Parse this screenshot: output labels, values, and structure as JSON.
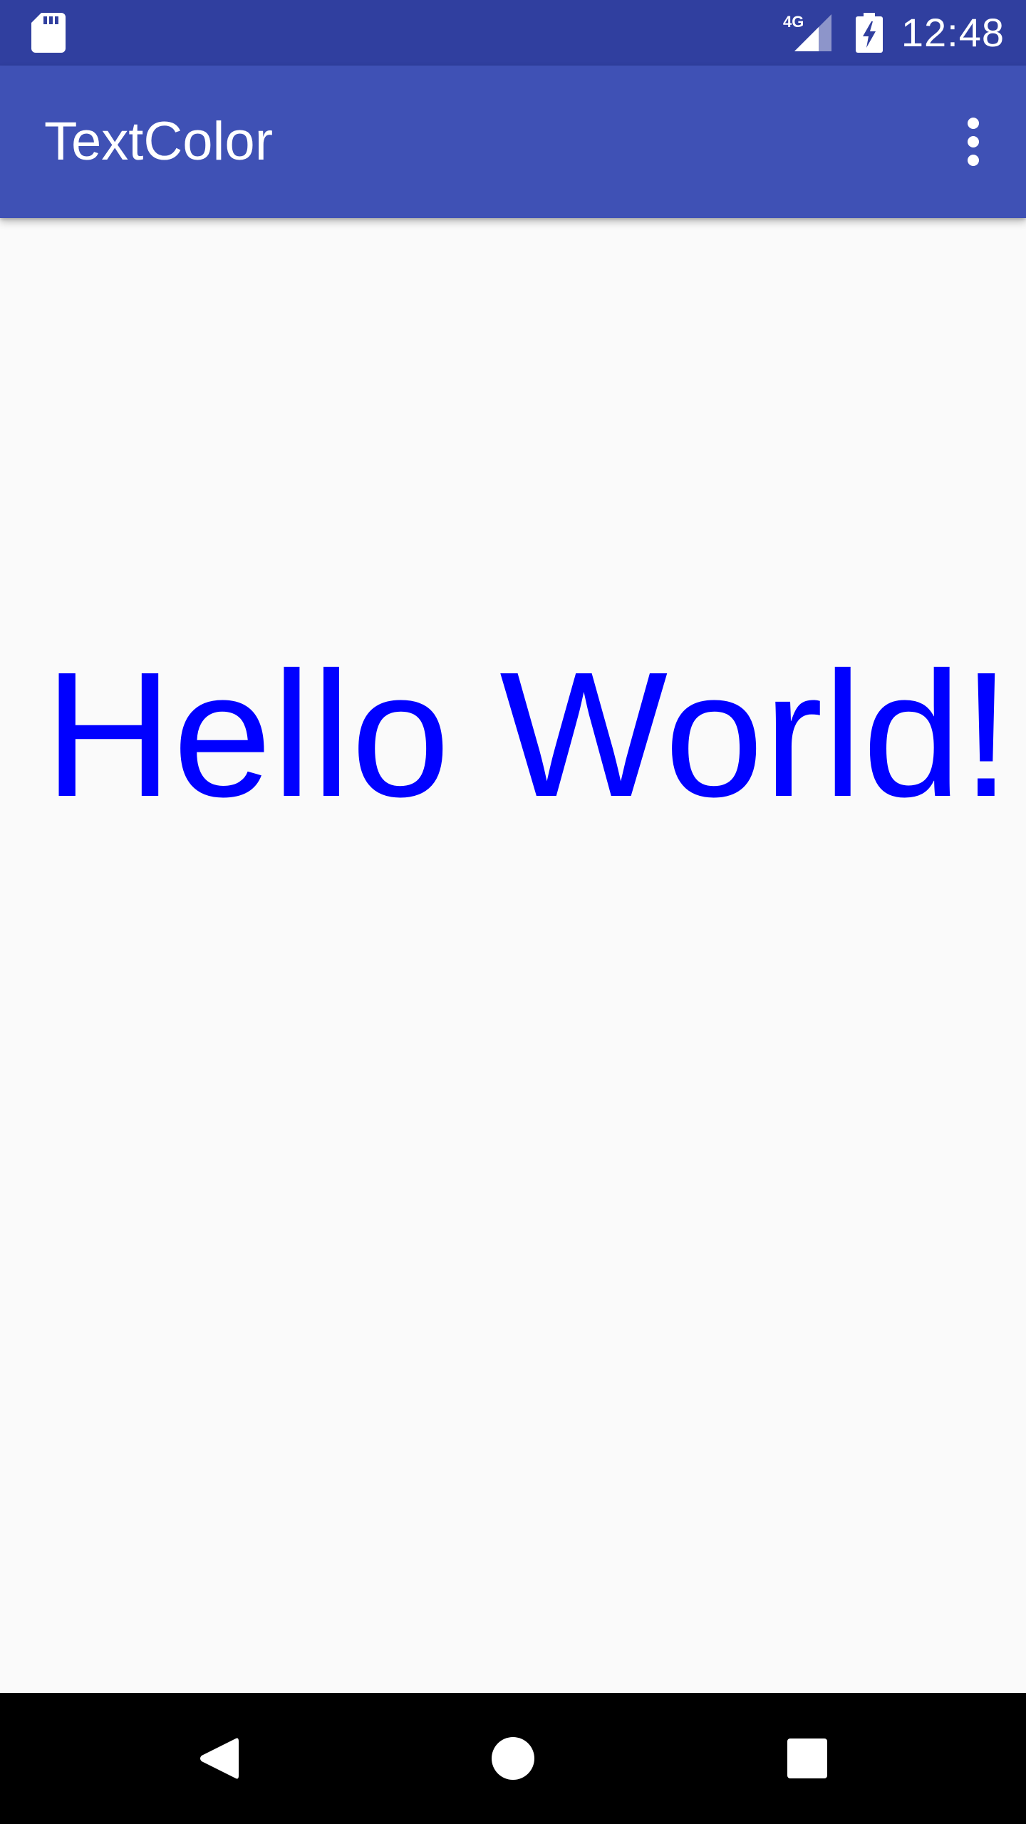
{
  "status_bar": {
    "time": "12:48",
    "network_label": "4G",
    "icons": [
      "sd-card-icon",
      "signal-icon",
      "battery-charging-icon"
    ]
  },
  "app_bar": {
    "title": "TextColor",
    "overflow_icon": "more-vert-icon"
  },
  "content": {
    "text": "Hello World!",
    "text_color": "#0000ff"
  },
  "nav_bar": {
    "icons": [
      "back-icon",
      "home-icon",
      "recents-icon"
    ]
  },
  "colors": {
    "status_bar": "#303f9f",
    "app_bar": "#3f51b5",
    "background": "#fafafa",
    "nav_bar": "#000000"
  }
}
